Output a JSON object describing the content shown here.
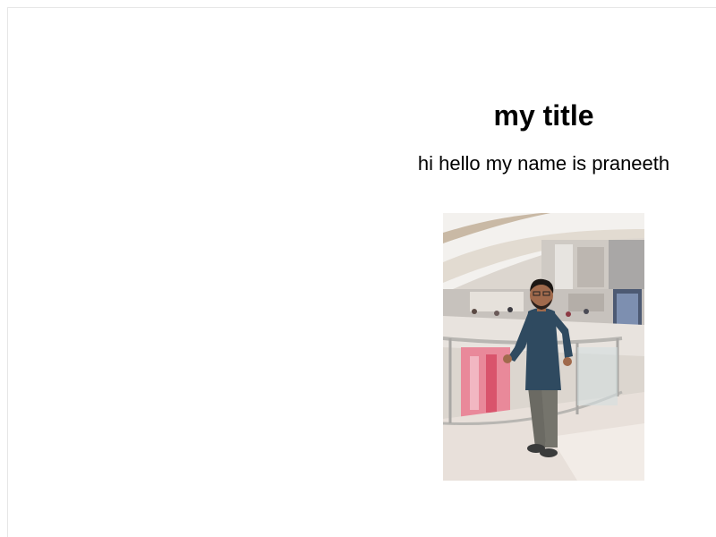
{
  "page": {
    "title": "my title",
    "text": "hi hello my name is praneeth"
  },
  "image": {
    "subject": "man standing by railing in shopping mall",
    "colors": {
      "ceiling": "#f3f1ee",
      "floor": "#e8e0da",
      "shirt": "#2f4a60",
      "pants": "#6b6a63",
      "skin": "#a06a4c",
      "hair": "#1c1714",
      "shop_pink": "#e9899a",
      "railing": "#b8b6b2"
    }
  }
}
